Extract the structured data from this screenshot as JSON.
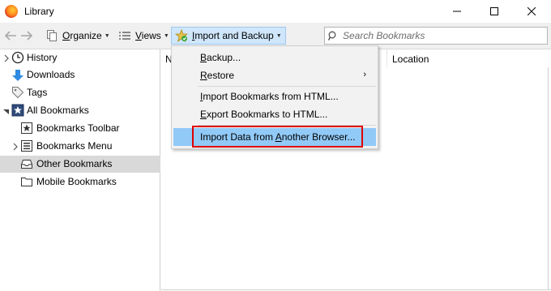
{
  "window": {
    "title": "Library",
    "controls": {
      "minimize": "minimize",
      "maximize": "maximize",
      "close": "close"
    }
  },
  "toolbar": {
    "organize_label": "Organize",
    "organize_accel": "O",
    "organize_rest": "rganize",
    "views_label": "Views",
    "views_accel": "V",
    "views_rest": "iews",
    "import_label": "Import and Backup",
    "import_accel": "I",
    "import_rest": "mport and Backup",
    "search_placeholder": "Search Bookmarks"
  },
  "sidebar": {
    "items": [
      {
        "label": "History",
        "icon": "clock-icon",
        "expandable": true,
        "selected": false
      },
      {
        "label": "Downloads",
        "icon": "download-arrow-icon",
        "expandable": false,
        "selected": false
      },
      {
        "label": "Tags",
        "icon": "tag-icon",
        "expandable": false,
        "selected": false
      },
      {
        "label": "All Bookmarks",
        "icon": "star-bookmark-icon",
        "expandable": true,
        "expanded": true,
        "selected": false
      },
      {
        "label": "Bookmarks Toolbar",
        "icon": "toolbar-star-icon",
        "expandable": false,
        "selected": false
      },
      {
        "label": "Bookmarks Menu",
        "icon": "menu-list-icon",
        "expandable": true,
        "selected": false
      },
      {
        "label": "Other Bookmarks",
        "icon": "tray-folder-icon",
        "expandable": false,
        "selected": true
      },
      {
        "label": "Mobile Bookmarks",
        "icon": "folder-icon",
        "expandable": false,
        "selected": false
      }
    ]
  },
  "columns": {
    "name_label": "N",
    "location_label": "Location"
  },
  "menu": {
    "items": [
      {
        "accel": "B",
        "rest": "ackup...",
        "pre": ""
      },
      {
        "accel": "R",
        "rest": "estore",
        "pre": "",
        "submenu": true
      },
      {
        "pre": "",
        "accel": "I",
        "rest": "mport Bookmarks from HTML..."
      },
      {
        "pre": "",
        "accel": "E",
        "rest": "xport Bookmarks to HTML..."
      },
      {
        "pre": "Import Data from ",
        "accel": "A",
        "rest": "nother Browser...",
        "highlighted": true
      }
    ]
  },
  "colors": {
    "highlight": "#91c9f7",
    "callout_border": "#e00000",
    "selected_row": "#d9d9d9",
    "active_button": "#cfe6fb"
  }
}
